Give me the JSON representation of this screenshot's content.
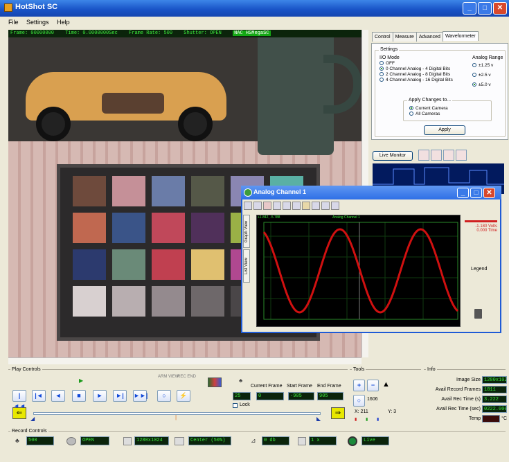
{
  "app": {
    "title": "HotShot SC"
  },
  "menu": [
    "File",
    "Settings",
    "Help"
  ],
  "status": {
    "frame": "Frame: 00000000",
    "time": "Time: 0.0000000Sec",
    "rate": "Frame Rate: 500",
    "shutter": "Shutter: OPEN",
    "camera": "NAC HSMegaSC"
  },
  "tabs": [
    "Control",
    "Measure",
    "Advanced",
    "Waveformeter"
  ],
  "waveform": {
    "settings_label": "Settings",
    "io_mode_label": "I/O Mode",
    "modes": [
      "OFF",
      "0 Channel Analog - 4 Digital Bits",
      "2 Channel Analog - 8 Digital Bits",
      "4 Channel Analog - 16 Digital Bits"
    ],
    "range_label": "Analog Range",
    "ranges": [
      "±1.25 v",
      "±2.5 v",
      "±5.0 v"
    ],
    "apply_label": "Apply Changes to...",
    "apply_options": [
      "Current Camera",
      "All Cameras"
    ],
    "apply_button": "Apply",
    "live_monitor": "Live Monitor"
  },
  "analog": {
    "title": "Analog Channel 1",
    "view_tabs": [
      "Graph View",
      "List View"
    ],
    "graph_title": "Analog Channel 1",
    "corner_readout": "+1.842, -5.788",
    "readout_volts": "-1.180 Volts",
    "readout_time": "0.000 Time",
    "legend": "Legend"
  },
  "play": {
    "label": "Play Controls",
    "arm": "ARM VIEW",
    "rec": "REC END",
    "buttons": [
      "|◄◄",
      "|◄",
      "◄",
      "■",
      "►",
      "►|",
      "►►|",
      "○",
      "⚡"
    ],
    "current_frame_label": "Current Frame",
    "start_frame_label": "Start Frame",
    "end_frame_label": "End Frame",
    "lock": "Lock",
    "spin_value": "25",
    "current_frame": "0",
    "start_frame": "-905",
    "end_frame": "905"
  },
  "tools": {
    "label": "Tools",
    "zoom_value": "1606",
    "x_label": "X: 211",
    "y_label": "Y: 3"
  },
  "info": {
    "label": "Info",
    "rows": [
      {
        "label": "Image Size",
        "value": "1280x1024"
      },
      {
        "label": "Avail Record Frames",
        "value": "1811"
      },
      {
        "label": "Avail Rec Time (s)",
        "value": "3.222"
      },
      {
        "label": "Avail Rec Time (sec)",
        "value": "0222.000"
      },
      {
        "label": "Temp",
        "value": "",
        "unit": "°C"
      }
    ]
  },
  "record": {
    "label": "Record Controls",
    "rate": "500",
    "shutter": "OPEN",
    "resolution": "1280x1024",
    "trigger": "Center (50%)",
    "gain": "0 db",
    "gain2": "1 x",
    "mode": "Live"
  }
}
